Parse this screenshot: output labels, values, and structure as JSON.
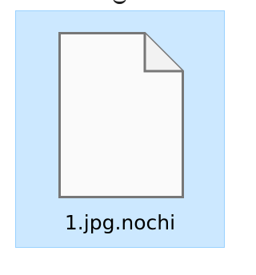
{
  "file": {
    "name": "1.jpg.nochi",
    "icon": "blank-document-icon",
    "selected": true
  },
  "colors": {
    "selection_fill": "#cce8ff",
    "selection_border": "#99d1ff",
    "icon_stroke": "#777777",
    "icon_fill": "#fafafa",
    "text": "#000000"
  }
}
